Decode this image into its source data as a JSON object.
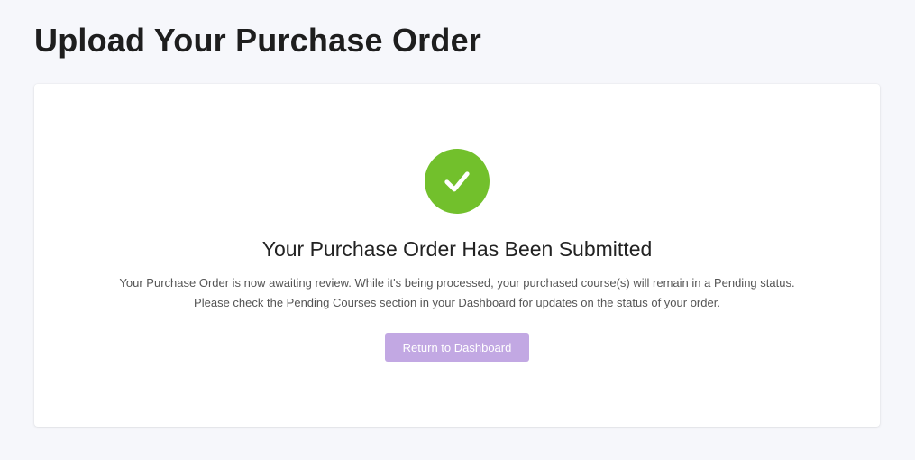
{
  "page": {
    "title": "Upload Your Purchase Order"
  },
  "confirmation": {
    "icon": "check-circle-icon",
    "icon_color": "#72c02c",
    "heading": "Your Purchase Order Has Been Submitted",
    "message_line1": "Your Purchase Order is now awaiting review. While it's being processed, your purchased course(s) will remain in a Pending status.",
    "message_line2": "Please check the Pending Courses section in your Dashboard for updates on the status of your order.",
    "button_label": "Return to Dashboard",
    "button_color": "#c2a8e3"
  }
}
